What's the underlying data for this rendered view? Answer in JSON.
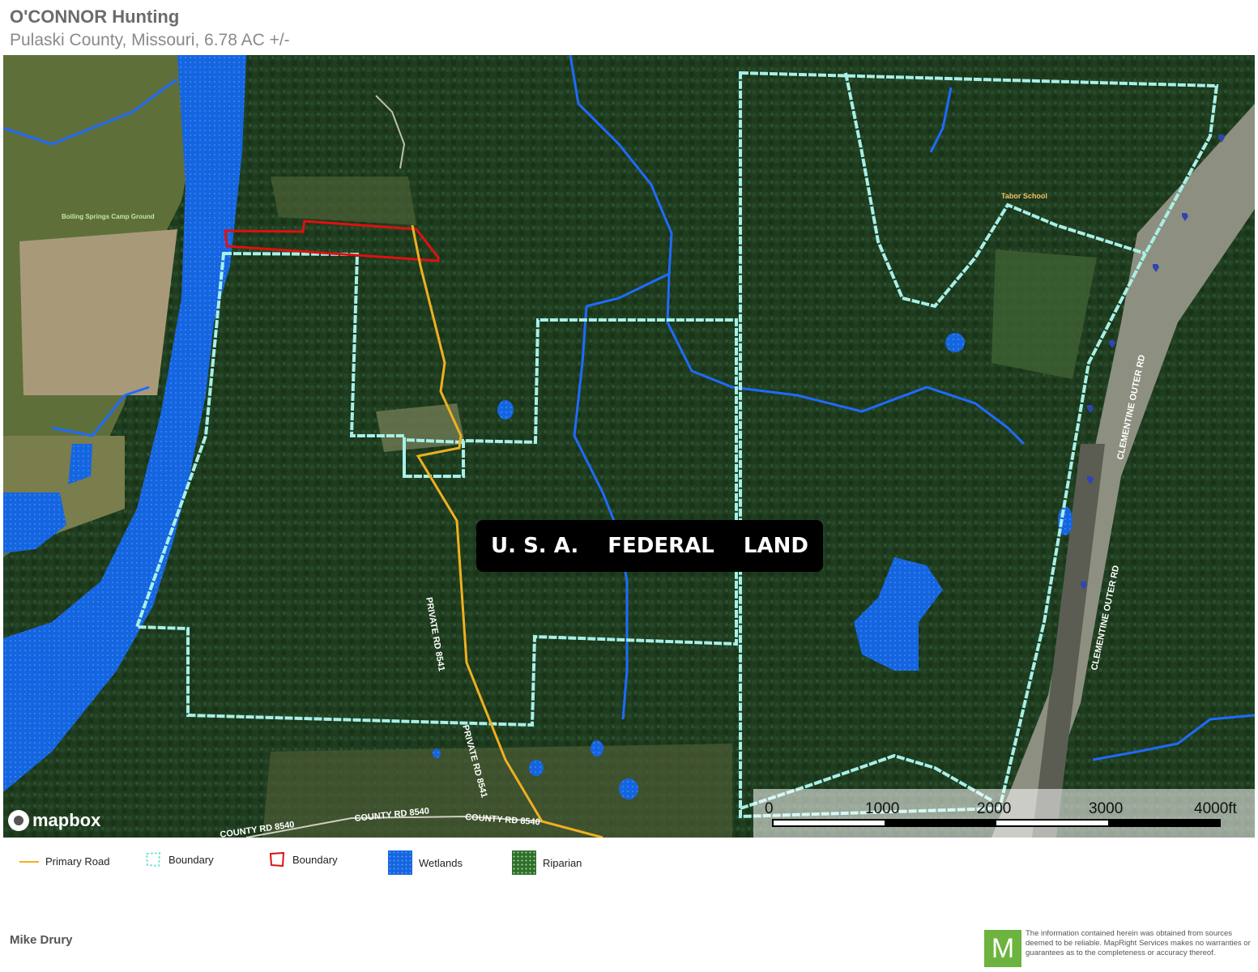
{
  "header": {
    "title": "O'CONNOR Hunting",
    "subtitle": "Pulaski County, Missouri, 6.78 AC +/-"
  },
  "map": {
    "overlay_label": [
      "U. S. A.",
      "FEDERAL",
      "LAND"
    ],
    "road_labels": {
      "private_rd_1": "PRIVATE RD 8541",
      "private_rd_2": "PRIVATE RD 8541",
      "county_rd_1": "COUNTY RD 8540",
      "county_rd_2": "COUNTY RD 8540",
      "county_rd_3": "COUNTY RD 8540",
      "clementine_1": "CLEMENTINE OUTER RD",
      "clementine_2": "CLEMENTINE OUTER RD",
      "tabor_school": "Tabor School",
      "boiling_springs": "Boiling Springs Camp Ground"
    },
    "attribution": "mapbox",
    "scale": {
      "ticks": [
        "0",
        "1000",
        "2000",
        "3000",
        "4000ft"
      ]
    },
    "colors": {
      "forest": "#1f3d1e",
      "water": "#1565e0",
      "boundary_cyan": "#a8f0e8",
      "boundary_red": "#e01010",
      "road": "#f0b020"
    }
  },
  "legend": [
    {
      "label": "Primary Road",
      "icon": "primary-road-line-icon"
    },
    {
      "label": "Boundary",
      "icon": "cyan-boundary-icon"
    },
    {
      "label": "Boundary",
      "icon": "red-boundary-icon"
    },
    {
      "label": "Wetlands",
      "icon": "wetlands-swatch-icon"
    },
    {
      "label": "Riparian",
      "icon": "riparian-swatch-icon"
    }
  ],
  "footer": {
    "agent": "Mike Drury",
    "logo_letter": "M",
    "disclaimer": "The information contained herein was obtained from sources deemed to be reliable. MapRight Services makes no warranties or guarantees as to the completeness or accuracy thereof."
  }
}
